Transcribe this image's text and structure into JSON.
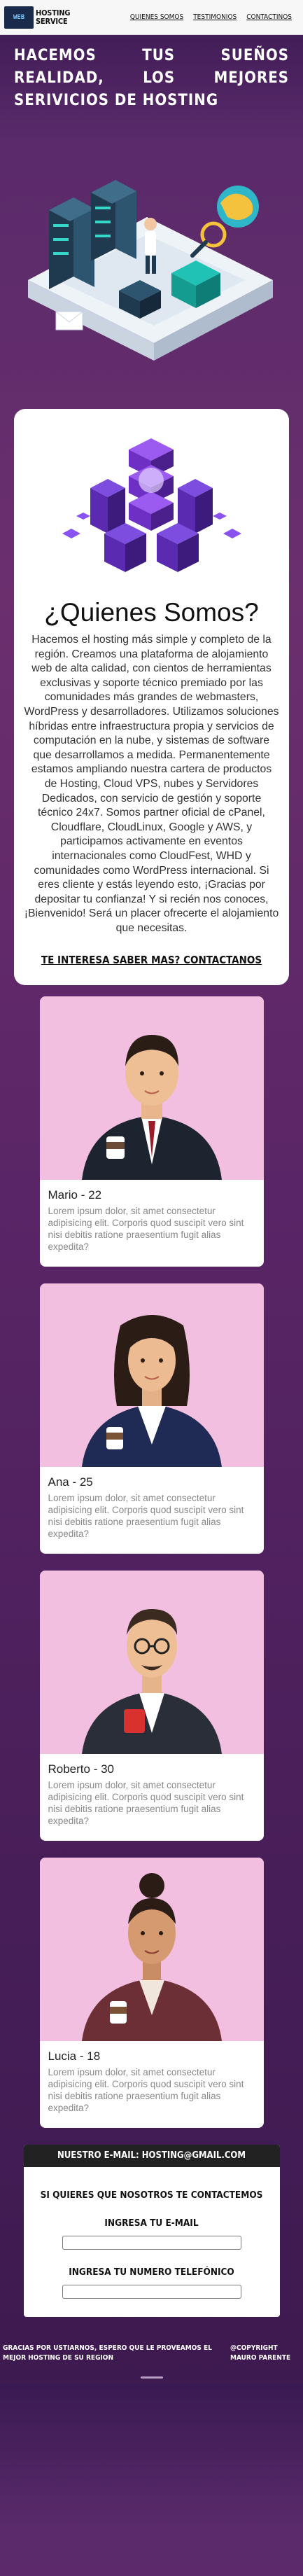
{
  "header": {
    "logo_mark": "WEB",
    "logo_text_1": "HOSTING",
    "logo_text_2": "SERVICE",
    "nav": [
      "Quienes Somos",
      "Testimonios",
      "Contactinos"
    ]
  },
  "hero": {
    "title": "Hacemos tus sueños realidad, los mejores serivicios de hosting"
  },
  "about": {
    "title": "¿Quienes Somos?",
    "text": "Hacemos el hosting más simple y completo de la región. Creamos una plataforma de alojamiento web de alta calidad, con cientos de herramientas exclusivas y soporte técnico premiado por las comunidades más grandes de webmasters, WordPress y desarrolladores. Utilizamos soluciones híbridas entre infraestructura propia y servicios de computación en la nube, y sistemas de software que desarrollamos a medida. Permanentemente estamos ampliando nuestra cartera de productos de Hosting, Cloud VPS, nubes y Servidores Dedicados, con servicio de gestión y soporte técnico 24x7. Somos partner oficial de cPanel, Cloudflare, CloudLinux, Google y AWS, y participamos activamente en eventos internacionales como CloudFest, WHD y comunidades como WordPress internacional. Si eres cliente y estás leyendo esto, ¡Gracias por depositar tu confianza! Y si recién nos conoces, ¡Bienvenido! Será un placer ofrecerte el alojamiento que necesitas.",
    "cta": "Te interesa saber mas? contactanos"
  },
  "team": [
    {
      "name": "Mario - 22",
      "desc": "Lorem ipsum dolor, sit amet consectetur adipisicing elit. Corporis quod suscipit vero sint nisi debitis ratione praesentium fugit alias expedita?"
    },
    {
      "name": "Ana - 25",
      "desc": "Lorem ipsum dolor, sit amet consectetur adipisicing elit. Corporis quod suscipit vero sint nisi debitis ratione praesentium fugit alias expedita?"
    },
    {
      "name": "Roberto - 30",
      "desc": "Lorem ipsum dolor, sit amet consectetur adipisicing elit. Corporis quod suscipit vero sint nisi debitis ratione praesentium fugit alias expedita?"
    },
    {
      "name": "Lucia - 18",
      "desc": "Lorem ipsum dolor, sit amet consectetur adipisicing elit. Corporis quod suscipit vero sint nisi debitis ratione praesentium fugit alias expedita?"
    }
  ],
  "contact": {
    "header": "Nuestro e-mail: hosting@gmail.com",
    "prompt": "Si quieres que nosotros te contactemos",
    "email_label": "Ingresa tu e-mail",
    "phone_label": "Ingresa tu numero telefónico"
  },
  "footer": {
    "left": "Gracias por ustiarnos, espero que le proveamos el mejor hosting de su region",
    "right": "@Copyright Mauro Parente"
  }
}
